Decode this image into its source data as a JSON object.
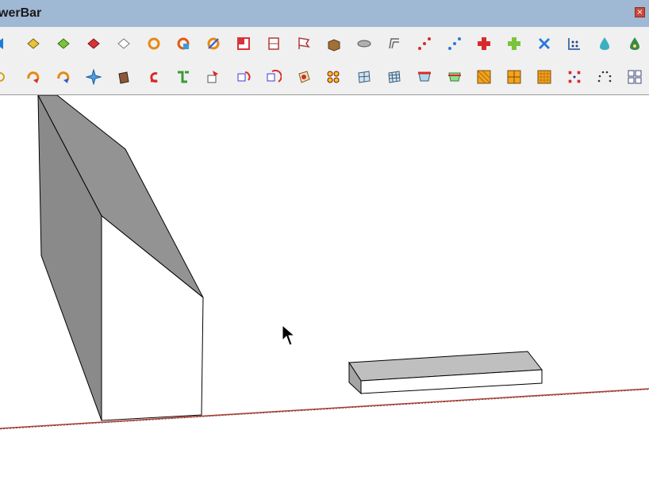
{
  "window": {
    "title": "werBar",
    "close_label": "×"
  },
  "toolbar": {
    "row1": [
      "arrow-tool-icon",
      "paint-bucket-yellow-icon",
      "paint-bucket-green-icon",
      "paint-bucket-red-icon",
      "paint-bucket-outline-icon",
      "orbit-orange-icon",
      "orbit-rainbow-icon",
      "orbit-blue-icon",
      "rectangle-red-icon",
      "section-plane-icon",
      "flag-icon",
      "wood-box-icon",
      "cylinder-gray-icon",
      "offset-edge-icon",
      "red-dots-icon",
      "blue-dots-icon",
      "red-cross-icon",
      "green-cross-icon",
      "blue-cross-icon",
      "grid-points-icon",
      "water-drop-icon",
      "warning-drop-icon"
    ],
    "row2": [
      "lasso-icon",
      "rotate-orange-icon",
      "rotate-blue-icon",
      "move-star-icon",
      "brown-box-icon",
      "undo-red-icon",
      "green-flow-icon",
      "push-pull-icon",
      "rotate-red-icon",
      "rotate-circle-icon",
      "red-stamp-icon",
      "four-dots-icon",
      "mesh-square-icon",
      "mesh-grid-icon",
      "red-plane-icon",
      "green-plane-icon",
      "orange-grid-icon",
      "orange-cross-grid-icon",
      "orange-fine-grid-icon",
      "scatter-icon",
      "arc-dots-icon",
      "grid-select-icon"
    ]
  },
  "scene": {
    "wall_shadow_color": "#8a8a8a",
    "wall_light_color": "#939393",
    "slab_top_color": "#bfbfbf",
    "slab_side_color": "#a5a5a5",
    "axis_color": "#b03a2e"
  }
}
